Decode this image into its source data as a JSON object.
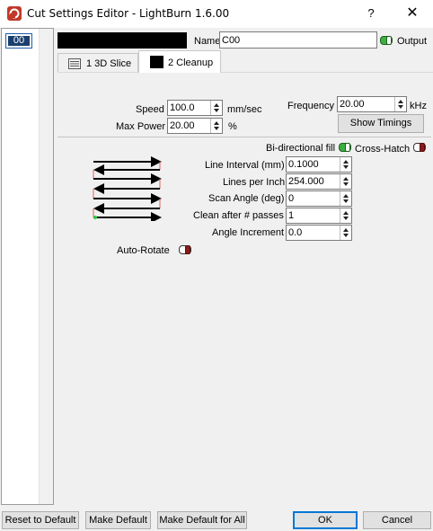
{
  "window": {
    "title": "Cut Settings Editor - LightBurn 1.6.00",
    "help_label": "?",
    "close_label": "✕"
  },
  "layer_list": {
    "items": [
      {
        "label": "00"
      }
    ]
  },
  "header": {
    "layer_color": "#000000",
    "name_label": "Name",
    "name_value": "C00",
    "output_label": "Output",
    "output_on": true
  },
  "tabs": [
    {
      "label": "1 3D Slice",
      "active": false
    },
    {
      "label": "2 Cleanup",
      "active": true
    }
  ],
  "form": {
    "speed_label": "Speed",
    "speed_value": "100.0",
    "speed_unit": "mm/sec",
    "max_power_label": "Max Power",
    "max_power_value": "20.00",
    "max_power_unit": "%",
    "frequency_label": "Frequency",
    "frequency_value": "20.00",
    "frequency_unit": "kHz",
    "show_timings_label": "Show Timings",
    "bidirectional_label": "Bi-directional fill",
    "bidirectional_on": true,
    "crosshatch_label": "Cross-Hatch",
    "crosshatch_on": false,
    "line_interval_label": "Line Interval (mm)",
    "line_interval_value": "0.1000",
    "lines_per_inch_label": "Lines per Inch",
    "lines_per_inch_value": "254.000",
    "scan_angle_label": "Scan Angle (deg)",
    "scan_angle_value": "0",
    "clean_after_label": "Clean after # passes",
    "clean_after_value": "1",
    "angle_increment_label": "Angle Increment",
    "angle_increment_value": "0.0",
    "auto_rotate_label": "Auto-Rotate",
    "auto_rotate_on": false
  },
  "footer": {
    "reset_label": "Reset to Default",
    "make_default_label": "Make Default",
    "make_default_all_label": "Make Default for All",
    "ok_label": "OK",
    "cancel_label": "Cancel"
  },
  "colors": {
    "toggle_on": "#3cb043",
    "toggle_off_knob": "#8b1a1a",
    "selection": "#1a3f6e",
    "accent": "#0078d7"
  }
}
